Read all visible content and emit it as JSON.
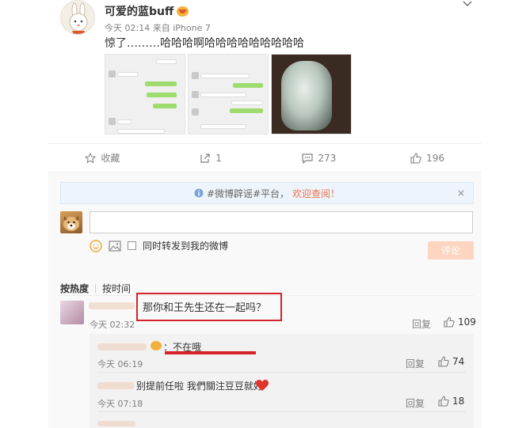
{
  "post": {
    "author": "可爱的蓝buff",
    "time": "今天 02:14",
    "source_prefix": "来自",
    "source": "iPhone 7",
    "text": "惊了………哈哈哈啊哈哈哈哈哈哈哈哈哈"
  },
  "actions": {
    "favorite": "收藏",
    "repost": "1",
    "comments": "273",
    "likes": "196"
  },
  "notice": {
    "text": "#微博辟谣#平台，",
    "link": "欢迎查阅！",
    "close": "×"
  },
  "composer": {
    "input_value": "",
    "repost_option": "同时转发到我的微博",
    "submit": "评论"
  },
  "sort": {
    "hot": "按热度",
    "time": "按时间"
  },
  "comment": {
    "text": "那你和王先生还在一起吗？",
    "time": "今天 02:32",
    "reply_label": "回复",
    "likes": "109"
  },
  "replies": [
    {
      "text": "：不在哦",
      "time": "今天 06:19",
      "reply_label": "回复",
      "likes": "74"
    },
    {
      "text": "别提前任啦 我們關注豆豆就好",
      "time": "今天 07:18",
      "reply_label": "回复",
      "likes": "18"
    }
  ],
  "colors": {
    "accent": "#eb7350",
    "highlight": "#d6222a",
    "submit_disabled": "#fdd5c0"
  }
}
